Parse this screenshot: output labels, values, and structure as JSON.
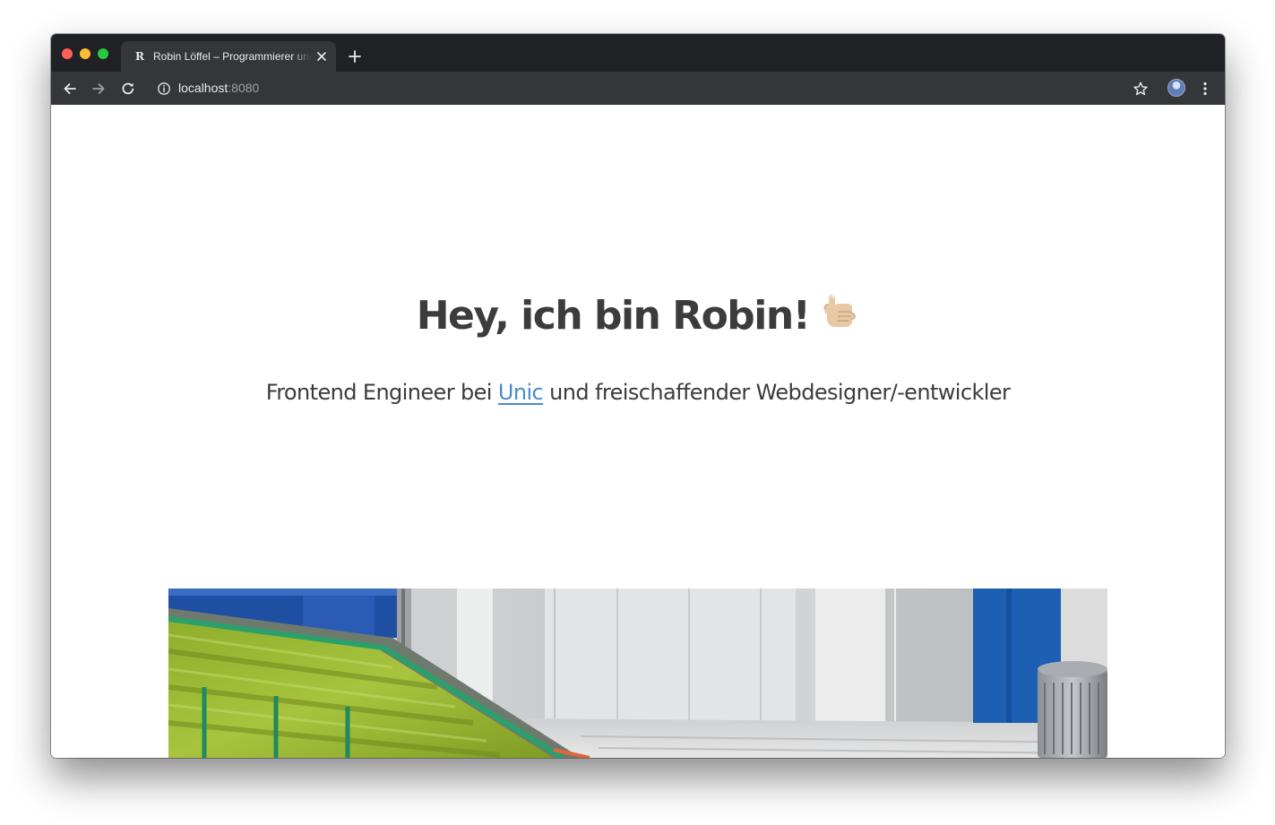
{
  "browser": {
    "tab": {
      "favicon_letter": "R",
      "title": "Robin Löffel – Programmierer und Gestalter"
    },
    "address": {
      "host": "localhost",
      "port": ":8080"
    },
    "icons": {
      "tab_close": "close-icon",
      "new_tab": "plus-icon",
      "back": "arrow-left-icon",
      "forward": "arrow-right-icon",
      "reload": "reload-icon",
      "site_info": "info-icon",
      "bookmark": "star-icon",
      "profile": "avatar",
      "menu": "kebab-menu-icon"
    },
    "colors": {
      "tab_strip": "#202124",
      "toolbar": "#35363a",
      "text": "#e8eaed",
      "dim_text": "#9aa0a6"
    }
  },
  "page": {
    "hero": {
      "title": "Hey, ich bin Robin!",
      "emoji_icon": "call-me-hand-icon",
      "subtitle_before": "Frontend Engineer bei ",
      "subtitle_link": "Unic",
      "subtitle_after": " und freischaffender Webdesigner/-entwickler"
    },
    "colors": {
      "text": "#3c3c3c",
      "link": "#4a8cc9"
    }
  }
}
